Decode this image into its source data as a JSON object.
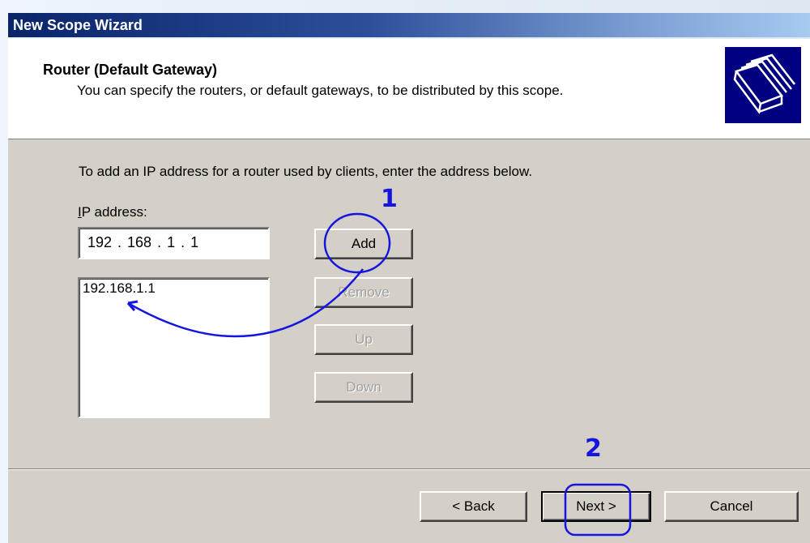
{
  "window": {
    "title": "New Scope Wizard"
  },
  "header": {
    "title": "Router (Default Gateway)",
    "subtitle": "You can specify the routers, or default gateways, to be distributed by this scope."
  },
  "body": {
    "instruction": "To add an IP address for a router used by clients, enter the address below.",
    "ip_label": "IP address:",
    "ip_value": "192 . 168 .  1  .  1",
    "list_items": [
      "192.168.1.1"
    ]
  },
  "buttons": {
    "add": "Add",
    "remove": "Remove",
    "up": "Up",
    "down": "Down",
    "back": "< Back",
    "next": "Next >",
    "cancel": "Cancel"
  },
  "annotations": {
    "step1": "1",
    "step2": "2"
  },
  "colors": {
    "titlebar_start": "#0a246a",
    "titlebar_end": "#a6caf0",
    "annotation": "#1515e0",
    "dialog_bg": "#d4d0c8"
  }
}
